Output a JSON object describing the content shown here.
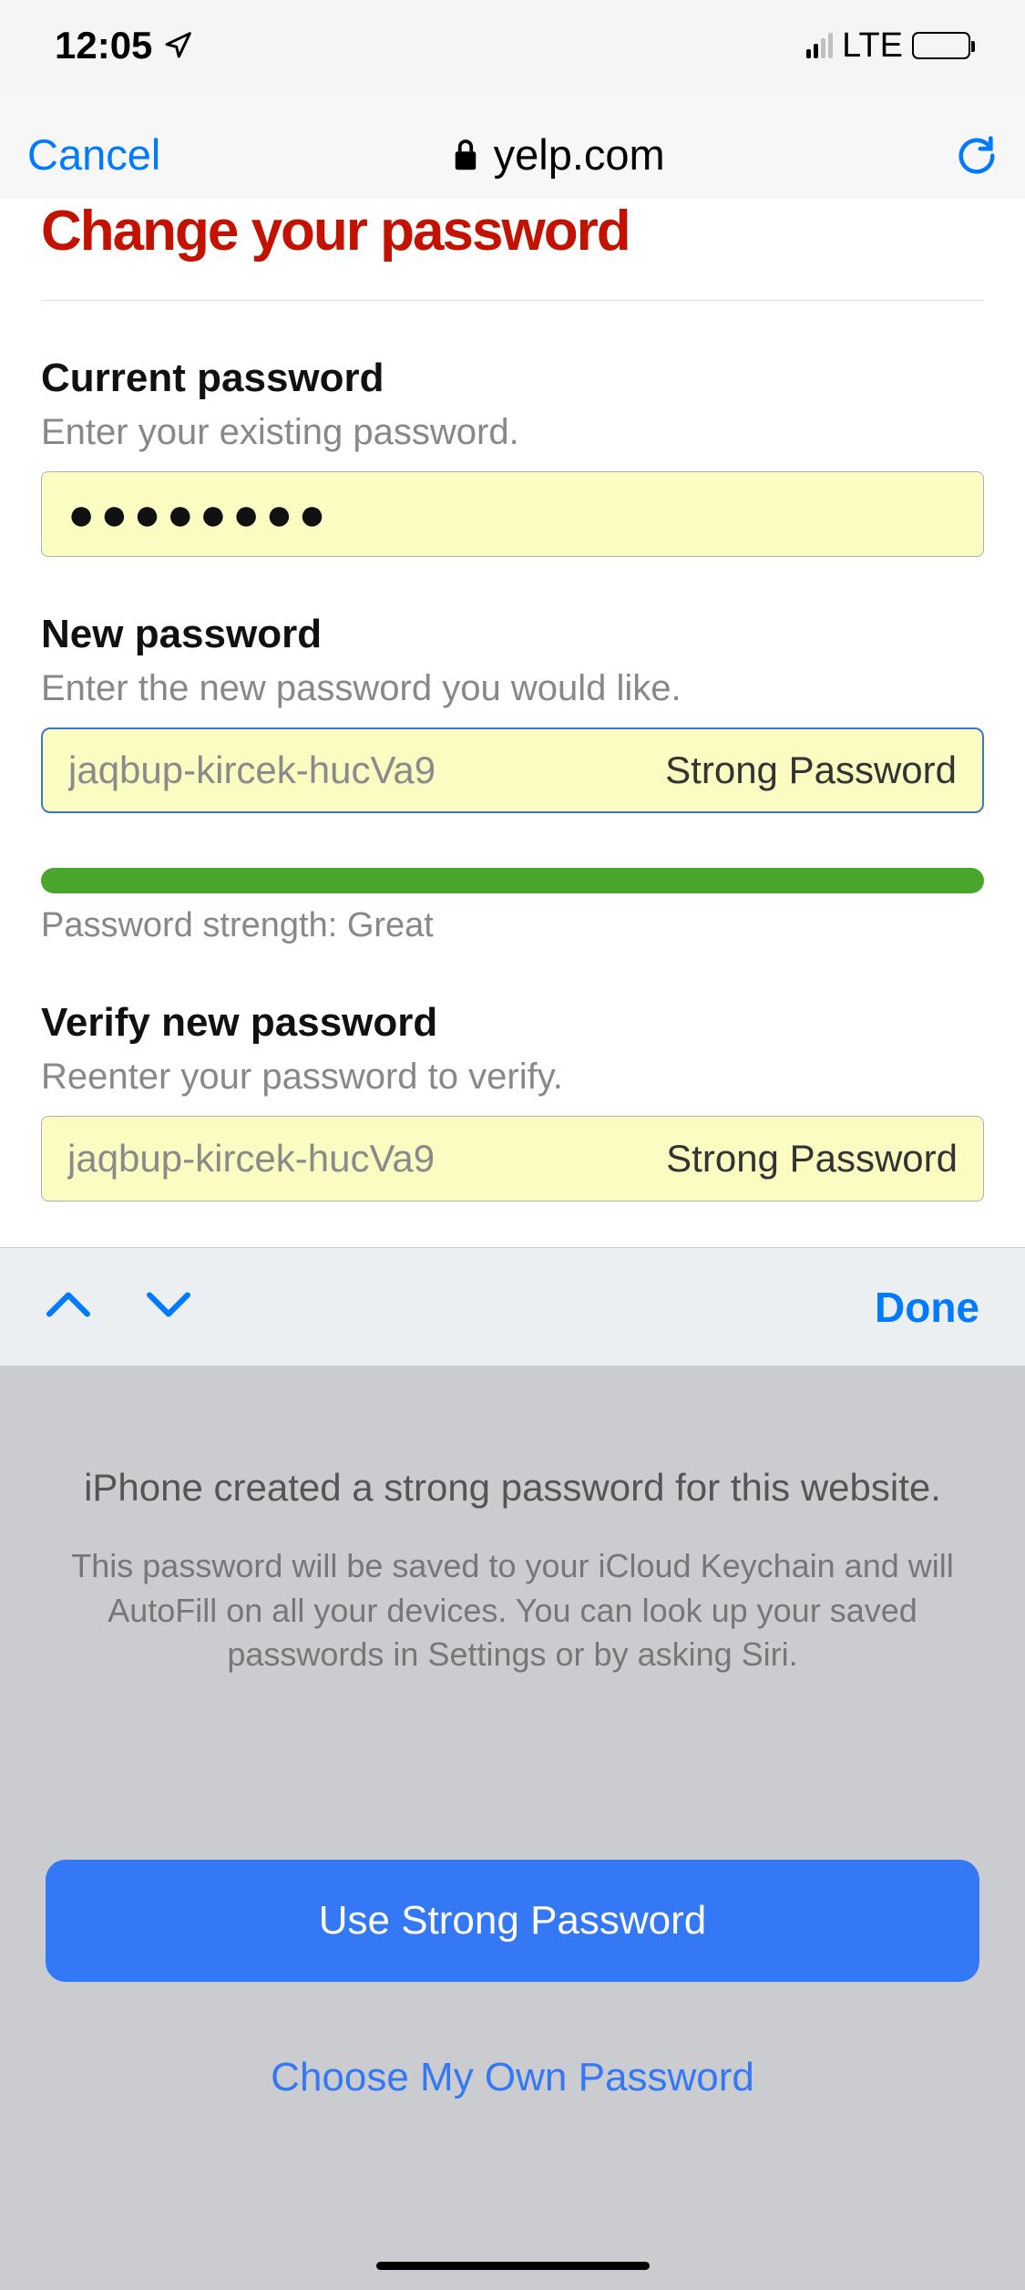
{
  "status": {
    "time": "12:05",
    "network": "LTE"
  },
  "browser": {
    "cancel": "Cancel",
    "domain": "yelp.com"
  },
  "page": {
    "heading": "Change your password",
    "current": {
      "label": "Current password",
      "hint": "Enter your existing password.",
      "mask": "●●●●●●●●"
    },
    "new": {
      "label": "New password",
      "hint": "Enter the new password you would like.",
      "suggested": "jaqbup-kircek-hucVa9",
      "strong_label": "Strong Password"
    },
    "strength": {
      "text": "Password strength: Great"
    },
    "verify": {
      "label": "Verify new password",
      "hint": "Reenter your password to verify.",
      "suggested": "jaqbup-kircek-hucVa9",
      "strong_label": "Strong Password"
    }
  },
  "accessory": {
    "done": "Done"
  },
  "panel": {
    "title": "iPhone created a strong password for this website.",
    "desc": "This password will be saved to your iCloud Keychain and will AutoFill on all your devices. You can look up your saved passwords in Settings or by asking Siri.",
    "use_strong": "Use Strong Password",
    "choose_own": "Choose My Own Password"
  }
}
